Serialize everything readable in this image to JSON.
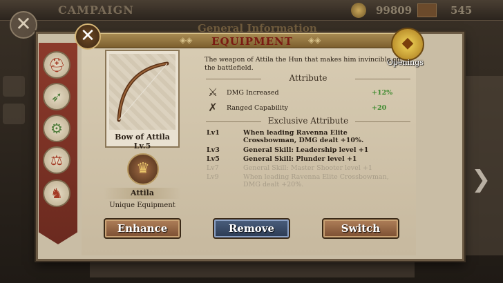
{
  "background": {
    "campaign_label": "CAMPAIGN",
    "gold": "99809",
    "gems": "545",
    "panel_title": "General Information",
    "close_label": "✕"
  },
  "dialog": {
    "title": "EQUIPMENT",
    "close_label": "✕",
    "openings_label": "Openings",
    "item_name": "Bow of Attila Lv.5",
    "hero_name": "Attila",
    "unique_label": "Unique Equipment",
    "description": "The weapon of Attila the Hun that makes him invincible on the battlefield.",
    "attribute_header": "Attribute",
    "attributes": [
      {
        "name": "DMG Increased",
        "value": "+12%",
        "icon": "sword-icon"
      },
      {
        "name": "Ranged Capability",
        "value": "+20",
        "icon": "crossbow-icon"
      }
    ],
    "exclusive_header": "Exclusive Attribute",
    "exclusive": [
      {
        "level": "Lv1",
        "text": "When leading Ravenna Elite Crossbowman, DMG dealt +10%.",
        "active": true
      },
      {
        "level": "Lv3",
        "text": "General Skill: Leadership level +1",
        "active": true
      },
      {
        "level": "Lv5",
        "text": "General Skill: Plunder level +1",
        "active": true
      },
      {
        "level": "Lv7",
        "text": "General Skill: Master Shooter level +1",
        "active": false
      },
      {
        "level": "Lv9",
        "text": "When leading Ravenna Elite Crossbowman, DMG dealt +20%.",
        "active": false
      }
    ],
    "buttons": {
      "enhance": "Enhance",
      "remove": "Remove",
      "switch": "Switch"
    }
  },
  "colors": {
    "accent_red": "#7a1a12",
    "bonus_green": "#3d8a2e",
    "remove_blue": "#2b3a52"
  }
}
